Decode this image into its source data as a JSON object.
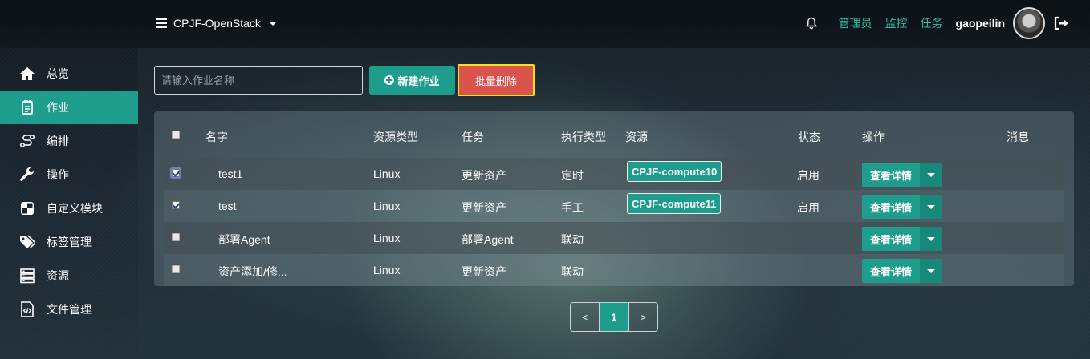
{
  "header": {
    "project": "CPJF-OpenStack",
    "links": [
      "管理员",
      "监控",
      "任务"
    ],
    "username": "gaopeilin"
  },
  "sidebar": {
    "items": [
      {
        "label": "总览",
        "icon": "home-icon"
      },
      {
        "label": "作业",
        "icon": "notepad-icon",
        "active": true
      },
      {
        "label": "编排",
        "icon": "flow-icon"
      },
      {
        "label": "操作",
        "icon": "wrench-icon"
      },
      {
        "label": "自定义模块",
        "icon": "module-icon"
      },
      {
        "label": "标签管理",
        "icon": "tags-icon"
      },
      {
        "label": "资源",
        "icon": "server-icon"
      },
      {
        "label": "文件管理",
        "icon": "file-code-icon"
      }
    ]
  },
  "toolbar": {
    "search_placeholder": "请输入作业名称",
    "new_label": "新建作业",
    "delete_label": "批量删除"
  },
  "table": {
    "headers": [
      "名字",
      "资源类型",
      "任务",
      "执行类型",
      "资源",
      "状态",
      "操作",
      "消息"
    ],
    "rows": [
      {
        "checked": true,
        "name": "test1",
        "type": "Linux",
        "task": "更新资产",
        "exec": "定时",
        "resource": "CPJF-compute10",
        "status": "启用",
        "action": "查看详情"
      },
      {
        "checked": true,
        "name": "test",
        "type": "Linux",
        "task": "更新资产",
        "exec": "手工",
        "resource": "CPJF-compute11",
        "status": "启用",
        "action": "查看详情"
      },
      {
        "checked": false,
        "name": "部署Agent",
        "type": "Linux",
        "task": "部署Agent",
        "exec": "联动",
        "resource": "",
        "status": "",
        "action": "查看详情"
      },
      {
        "checked": false,
        "name": "资产添加/修...",
        "type": "Linux",
        "task": "更新资产",
        "exec": "联动",
        "resource": "",
        "status": "",
        "action": "查看详情"
      }
    ]
  },
  "pagination": {
    "prev": "<",
    "current": "1",
    "next": ">"
  },
  "colors": {
    "accent": "#1e9d8d",
    "danger": "#d9534f",
    "highlight_border": "#f2e21a",
    "link": "#35b8a0"
  }
}
